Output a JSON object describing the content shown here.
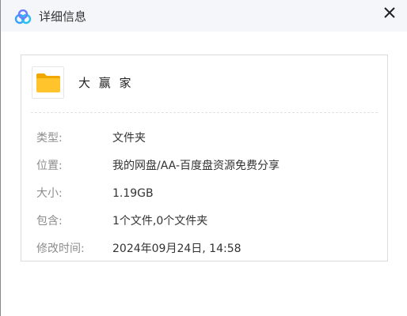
{
  "window": {
    "title": "详细信息",
    "app_icon": "baidu-netdisk-icon",
    "close_icon": "close-icon"
  },
  "file": {
    "icon": "folder-icon",
    "name": "大 赢 家"
  },
  "details": [
    {
      "label": "类型:",
      "value": "文件夹"
    },
    {
      "label": "位置:",
      "value": "我的网盘/AA-百度盘资源免费分享"
    },
    {
      "label": "大小:",
      "value": "1.19GB"
    },
    {
      "label": "包含:",
      "value": "1个文件,0个文件夹"
    },
    {
      "label": "修改时间:",
      "value": "2024年09月24日, 14:58"
    }
  ],
  "colors": {
    "titlebar_bg": "#f4f6f9",
    "folder_yellow": "#ffc42c",
    "label_gray": "#8c8c8c",
    "icon_blue": "#3aa0ff"
  }
}
